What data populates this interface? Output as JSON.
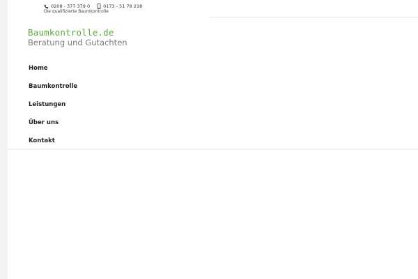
{
  "header": {
    "phone": {
      "icon": "phone-icon",
      "number": "0208 - 377 379 0"
    },
    "mobile": {
      "icon": "mobile-phone-icon",
      "number": "0173 - 51 78 218"
    },
    "tagline": "Die qualifizierte Baumkontrolle"
  },
  "logo": {
    "line1": "Baumkontrolle.de",
    "line2": "Beratung und Gutachten",
    "colors": {
      "line1": "#5aa83b",
      "line2": "#7a7a7a"
    }
  },
  "nav": {
    "items": [
      {
        "label": "Home"
      },
      {
        "label": "Baumkontrolle"
      },
      {
        "label": "Leistungen"
      },
      {
        "label": "Über uns"
      },
      {
        "label": "Kontakt"
      }
    ]
  }
}
